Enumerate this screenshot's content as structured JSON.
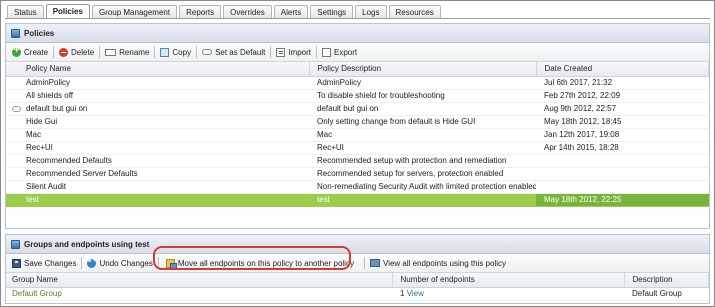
{
  "tabs": [
    {
      "label": "Status",
      "active": false
    },
    {
      "label": "Policies",
      "active": true
    },
    {
      "label": "Group Management",
      "active": false
    },
    {
      "label": "Reports",
      "active": false
    },
    {
      "label": "Overrides",
      "active": false
    },
    {
      "label": "Alerts",
      "active": false
    },
    {
      "label": "Settings",
      "active": false
    },
    {
      "label": "Logs",
      "active": false
    },
    {
      "label": "Resources",
      "active": false
    }
  ],
  "policies_panel": {
    "title": "Policies",
    "toolbar": {
      "create": "Create",
      "delete": "Delete",
      "rename": "Rename",
      "copy": "Copy",
      "set_default": "Set as Default",
      "import": "Import",
      "export": "Export"
    },
    "columns": {
      "name": "Policy Name",
      "description": "Policy Description",
      "date": "Date Created"
    },
    "rows": [
      {
        "name": "AdminPolicy",
        "description": "AdminPolicy",
        "date": "Jul 6th 2017, 21:32",
        "icon": "",
        "selected": false
      },
      {
        "name": "All shields off",
        "description": "To disable shield for troubleshooting",
        "date": "Feb 27th 2012, 22:09",
        "icon": "",
        "selected": false
      },
      {
        "name": "default but gui on",
        "description": "default but gui on",
        "date": "Aug 9th 2012, 22:57",
        "icon": "default-policy-icon",
        "selected": false
      },
      {
        "name": "Hide Gui",
        "description": "Only setting change from default is Hide GUI",
        "date": "May 18th 2012, 18:45",
        "icon": "",
        "selected": false
      },
      {
        "name": "Mac",
        "description": "Mac",
        "date": "Jan 12th 2017, 19:08",
        "icon": "",
        "selected": false
      },
      {
        "name": "Rec+UI",
        "description": "Rec+UI",
        "date": "Apr 14th 2015, 18:28",
        "icon": "",
        "selected": false
      },
      {
        "name": "Recommended Defaults",
        "description": "Recommended setup with protection and remediation",
        "date": "",
        "icon": "",
        "selected": false
      },
      {
        "name": "Recommended Server Defaults",
        "description": "Recommended setup for servers, protection enabled",
        "date": "",
        "icon": "",
        "selected": false
      },
      {
        "name": "Silent Audit",
        "description": "Non-remediating Security Audit with limited protection enabled",
        "date": "",
        "icon": "",
        "selected": false
      },
      {
        "name": "test",
        "description": "test",
        "date": "May 18th 2012, 22:25",
        "icon": "",
        "selected": true
      }
    ],
    "selected_color": "#9ccd4a"
  },
  "groups_panel": {
    "title": "Groups and endpoints using test",
    "toolbar": {
      "save": "Save Changes",
      "undo": "Undo Changes",
      "move": "Move all endpoints on this policy to another policy",
      "view": "View all endpoints using this policy"
    },
    "columns": {
      "group": "Group Name",
      "count": "Number of endpoints",
      "description": "Description"
    },
    "rows": [
      {
        "group": "Default Group",
        "count": "1",
        "view": "View",
        "description": "Default Group"
      }
    ]
  },
  "highlight_color": "#d93a2f"
}
